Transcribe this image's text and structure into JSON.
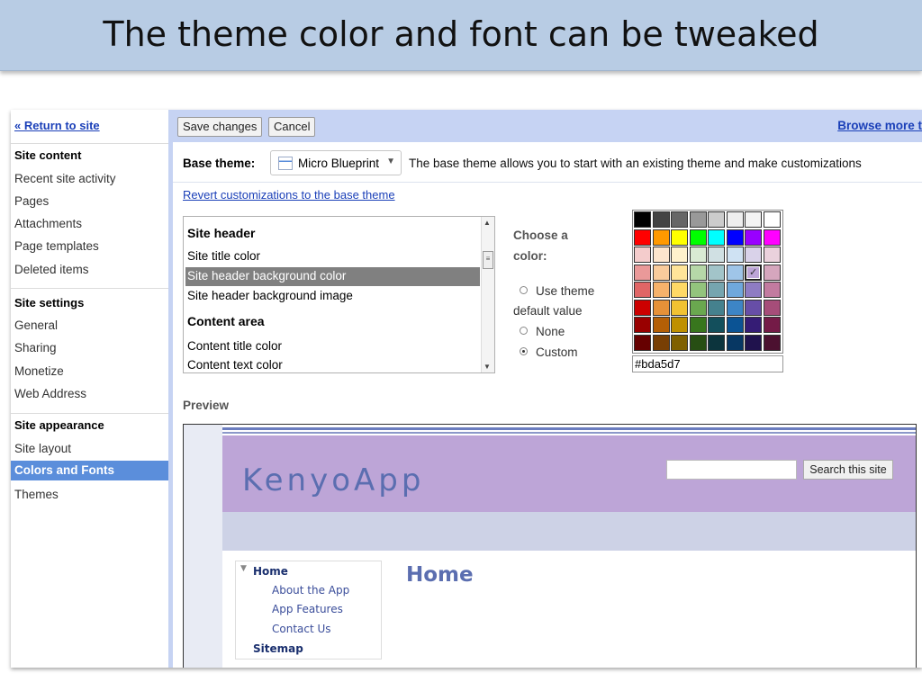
{
  "slide": {
    "title": "The theme color and font can be tweaked"
  },
  "sidebar": {
    "return_link": "« Return to site",
    "sections": [
      {
        "heading": "Site content",
        "items": [
          "Recent site activity",
          "Pages",
          "Attachments",
          "Page templates",
          "Deleted items"
        ]
      },
      {
        "heading": "Site settings",
        "items": [
          "General",
          "Sharing",
          "Monetize",
          "Web Address"
        ]
      },
      {
        "heading": "Site appearance",
        "items": [
          "Site layout",
          "Colors and Fonts",
          "Themes"
        ]
      }
    ],
    "active_item": "Colors and Fonts"
  },
  "toolbar": {
    "save_label": "Save changes",
    "cancel_label": "Cancel",
    "browse_label": "Browse more t"
  },
  "base_theme": {
    "label": "Base theme:",
    "selected": "Micro Blueprint",
    "description": "The base theme allows you to start with an existing theme and make customizations"
  },
  "revert_link": "Revert customizations to the base theme",
  "element_list": [
    {
      "label": "Site header",
      "kind": "heading"
    },
    {
      "label": "Site title color",
      "kind": "item"
    },
    {
      "label": "Site header background color",
      "kind": "item",
      "selected": true
    },
    {
      "label": "Site header background image",
      "kind": "item"
    },
    {
      "label": "Content area",
      "kind": "heading"
    },
    {
      "label": "Content title color",
      "kind": "item"
    },
    {
      "label": "Content text color",
      "kind": "item"
    }
  ],
  "color_chooser": {
    "prompt_line1": "Choose a",
    "prompt_line2": "color:",
    "option_theme_line1": "Use theme",
    "option_theme_line2": "default value",
    "option_none": "None",
    "option_custom": "Custom",
    "selected_option": "Custom",
    "hex_value": "#bda5d7",
    "palette_rows": [
      [
        "#000000",
        "#444444",
        "#666666",
        "#999999",
        "#cccccc",
        "#eeeeee",
        "#f3f3f3",
        "#ffffff"
      ],
      [
        "#ff0000",
        "#ff9900",
        "#ffff00",
        "#00ff00",
        "#00ffff",
        "#0000ff",
        "#9900ff",
        "#ff00ff"
      ],
      [
        "#f4cccc",
        "#fce5cd",
        "#fff2cc",
        "#d9ead3",
        "#d0e0e3",
        "#cfe2f3",
        "#d9d2e9",
        "#ead1dc"
      ],
      [
        "#ea9999",
        "#f9cb9c",
        "#ffe599",
        "#b6d7a8",
        "#a2c4c9",
        "#9fc5e8",
        "#bda5d7",
        "#d5a6bd"
      ],
      [
        "#e06666",
        "#f6b26b",
        "#ffd966",
        "#93c47d",
        "#76a5af",
        "#6fa8dc",
        "#8e7cc3",
        "#c27ba0"
      ],
      [
        "#cc0000",
        "#e69138",
        "#f1c232",
        "#6aa84f",
        "#45818e",
        "#3d85c6",
        "#674ea7",
        "#a64d79"
      ],
      [
        "#990000",
        "#b45f06",
        "#bf9000",
        "#38761d",
        "#134f5c",
        "#0b5394",
        "#351c75",
        "#741b47"
      ],
      [
        "#660000",
        "#783f04",
        "#7f6000",
        "#274e13",
        "#0c343d",
        "#073763",
        "#20124d",
        "#4c1130"
      ]
    ],
    "picked_cell": {
      "row": 3,
      "col": 6
    }
  },
  "preview": {
    "label": "Preview",
    "site_title": "KenyoApp",
    "search_button": "Search this site",
    "nav": {
      "home": "Home",
      "children": [
        "About the App",
        "App Features",
        "Contact Us"
      ],
      "sitemap": "Sitemap"
    },
    "page_title": "Home",
    "header_color": "#bda5d7",
    "title_color": "#5b6eb0"
  },
  "colors": {
    "link": "#1a3fb8",
    "sidebar_active": "#5b8edb",
    "toolbar_bg": "#c6d3f3",
    "banner_bg": "#b8cce4"
  }
}
